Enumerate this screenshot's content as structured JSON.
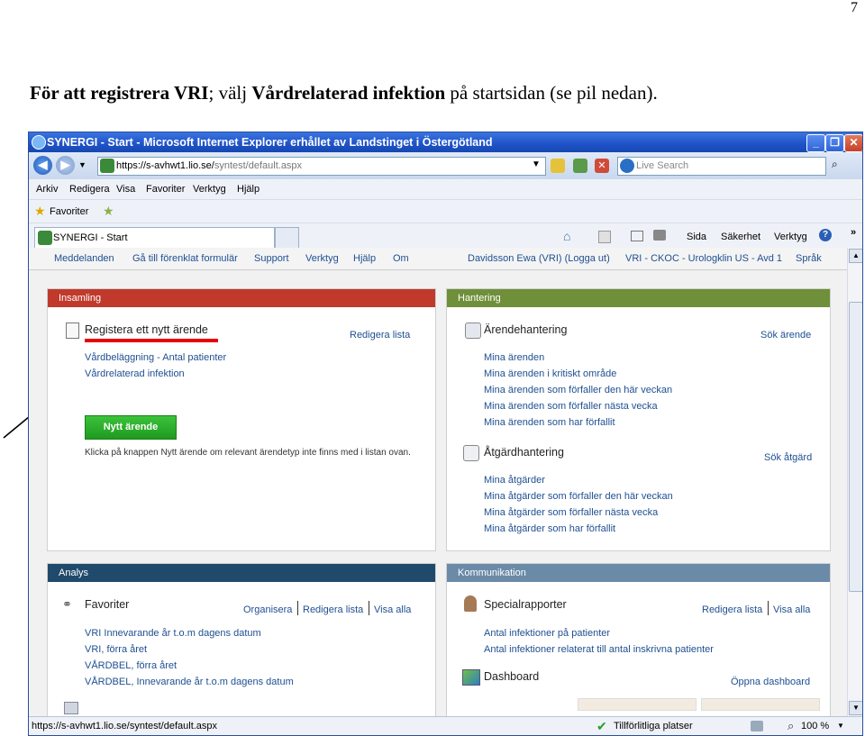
{
  "page_number": "7",
  "heading": {
    "part1": "För att registrera VRI",
    "part2": "; välj ",
    "part3": "Vårdrelaterad infektion",
    "part4": " på startsidan (se pil nedan)."
  },
  "browser": {
    "title": "SYNERGI - Start - Microsoft Internet Explorer erhållet av Landstinget i Östergötland",
    "url_prefix": "https://s-avhwt1.lio.se/",
    "url_rest": "syntest/default.aspx",
    "search_placeholder": "Live Search",
    "menu": [
      "Arkiv",
      "Redigera",
      "Visa",
      "Favoriter",
      "Verktyg",
      "Hjälp"
    ],
    "favorites_label": "Favoriter",
    "tab_label": "SYNERGI - Start",
    "commands": [
      "Sida",
      "Säkerhet",
      "Verktyg"
    ],
    "status_url": "https://s-avhwt1.lio.se/syntest/default.aspx",
    "status_zone": "Tillförlitliga platser",
    "zoom": "100 %"
  },
  "app_nav": {
    "left": [
      "Meddelanden",
      "Gå till förenklat formulär",
      "Support",
      "Verktyg",
      "Hjälp",
      "Om"
    ],
    "user": "Davidsson Ewa (VRI) (Logga ut)",
    "unit": "VRI - CKOC - Urologklin US - Avd 1",
    "language": "Språk"
  },
  "insamling": {
    "header": "Insamling",
    "section_title": "Registera ett nytt ärende",
    "edit_link": "Redigera lista",
    "links": [
      "Vårdbeläggning - Antal patienter",
      "Vårdrelaterad infektion"
    ],
    "button": "Nytt ärende",
    "note": "Klicka på knappen Nytt ärende om relevant ärendetyp inte finns med i listan ovan."
  },
  "hantering": {
    "header": "Hantering",
    "s1_title": "Ärendehantering",
    "s1_action": "Sök ärende",
    "s1_links": [
      "Mina ärenden",
      "Mina ärenden i kritiskt område",
      "Mina ärenden som förfaller den här veckan",
      "Mina ärenden som förfaller nästa vecka",
      "Mina ärenden som har förfallit"
    ],
    "s2_title": "Åtgärdhantering",
    "s2_action": "Sök åtgärd",
    "s2_links": [
      "Mina åtgärder",
      "Mina åtgärder som förfaller den här veckan",
      "Mina åtgärder som förfaller nästa vecka",
      "Mina åtgärder som har förfallit"
    ]
  },
  "analys": {
    "header": "Analys",
    "title": "Favoriter",
    "actions": [
      "Organisera",
      "Redigera lista",
      "Visa alla"
    ],
    "links": [
      "VRI Innevarande år t.o.m dagens datum",
      "VRI, förra året",
      "VÅRDBEL, förra året",
      "VÅRDBEL, Innevarande år t.o.m dagens datum"
    ]
  },
  "kommunikation": {
    "header": "Kommunikation",
    "s1_title": "Specialrapporter",
    "s1_actions": [
      "Redigera lista",
      "Visa alla"
    ],
    "s1_links": [
      "Antal infektioner på patienter",
      "Antal infektioner relaterat till antal inskrivna patienter"
    ],
    "s2_title": "Dashboard",
    "s2_action": "Öppna dashboard"
  },
  "colors": {
    "insamling": "#c0392b",
    "hantering": "#6f8f3a",
    "analys": "#1f4a6b",
    "kommunikation": "#6a8aa8",
    "link": "#1f4f91",
    "underline": "#e8000a"
  }
}
